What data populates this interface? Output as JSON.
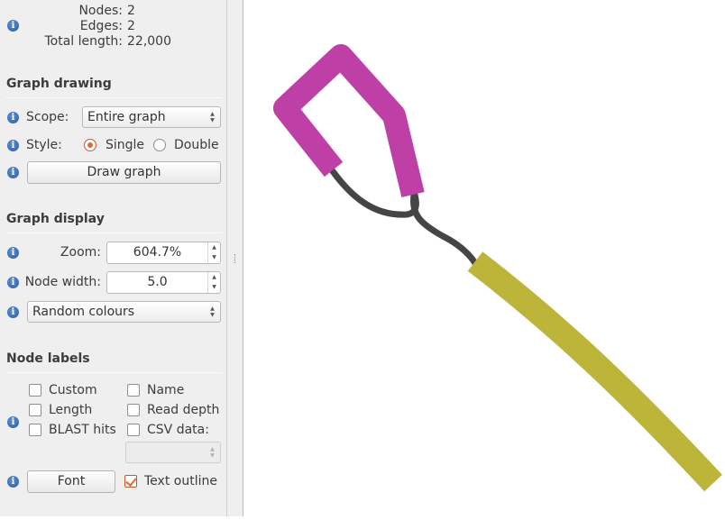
{
  "stats": {
    "nodes_label": "Nodes:",
    "nodes_value": "2",
    "edges_label": "Edges:",
    "edges_value": "2",
    "total_length_label": "Total length:",
    "total_length_value": "22,000"
  },
  "graph_drawing": {
    "heading": "Graph drawing",
    "scope_label": "Scope:",
    "scope_value": "Entire graph",
    "style_label": "Style:",
    "style_single": "Single",
    "style_double": "Double",
    "style_selected": "Single",
    "draw_button": "Draw graph"
  },
  "graph_display": {
    "heading": "Graph display",
    "zoom_label": "Zoom:",
    "zoom_value": "604.7%",
    "node_width_label": "Node width:",
    "node_width_value": "5.0",
    "colour_scheme": "Random colours"
  },
  "node_labels": {
    "heading": "Node labels",
    "custom": "Custom",
    "name": "Name",
    "length": "Length",
    "read_depth": "Read depth",
    "blast_hits": "BLAST hits",
    "csv_data": "CSV data:",
    "csv_select_value": "",
    "font_button": "Font",
    "text_outline": "Text outline",
    "text_outline_checked": true
  },
  "info_icon_glyph": "i",
  "colors": {
    "node_magenta": "#be40a6",
    "node_olive": "#bdb43a",
    "edge": "#454545",
    "accent": "#e0692f",
    "info": "#3a6fbd"
  }
}
